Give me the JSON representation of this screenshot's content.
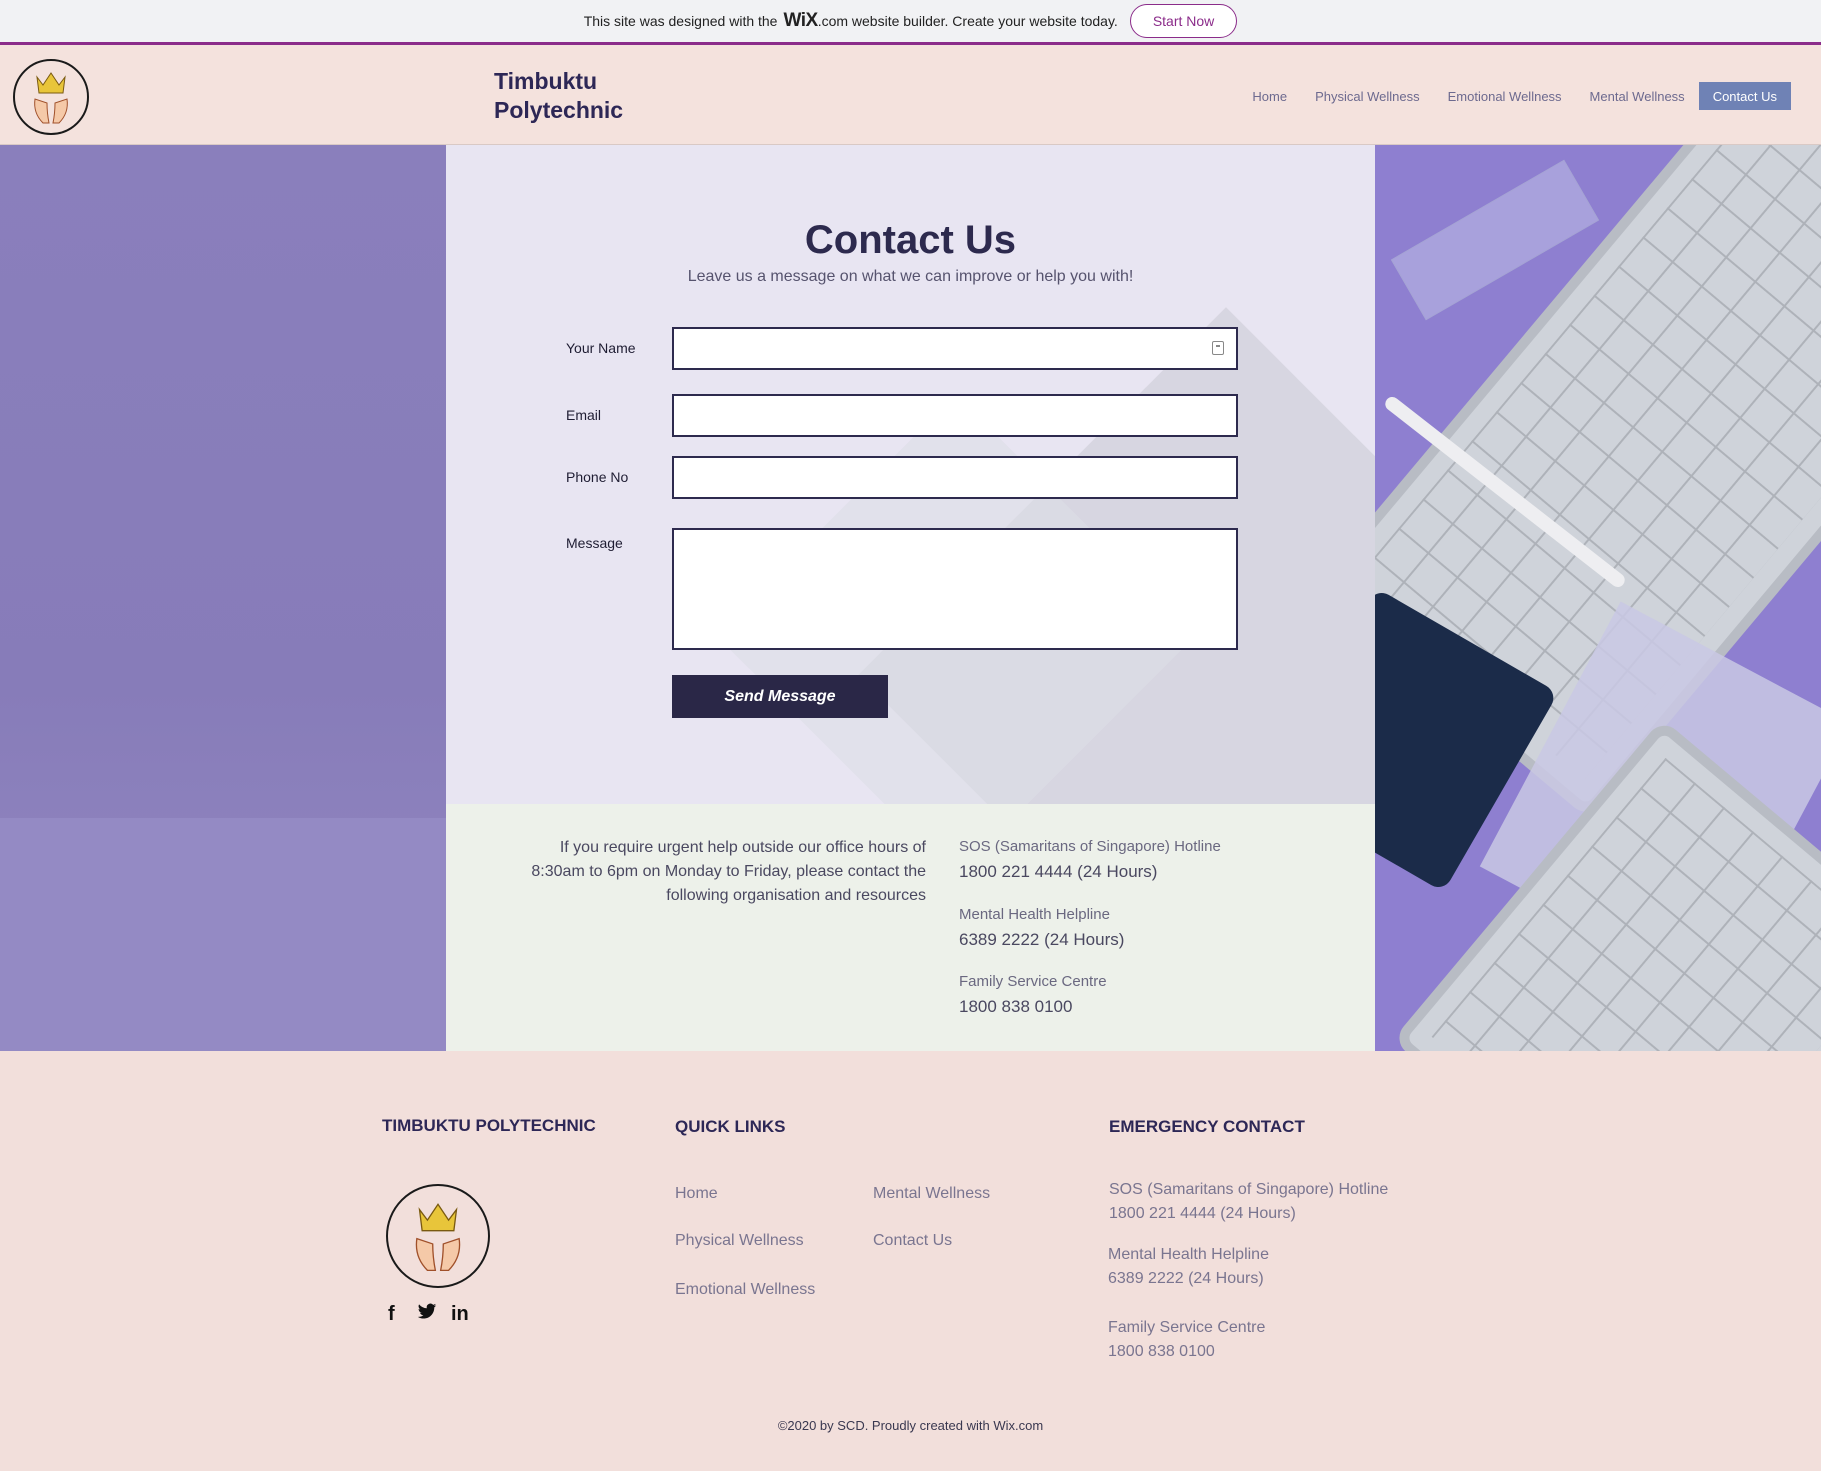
{
  "wix_banner": {
    "text_before": "This site was designed with the",
    "logo": "WiX",
    "text_after": ".com website builder. Create your website today.",
    "cta": "Start Now"
  },
  "header": {
    "brand_line1": "Timbuktu",
    "brand_line2": "Polytechnic",
    "nav": [
      "Home",
      "Physical Wellness",
      "Emotional Wellness",
      "Mental Wellness",
      "Contact Us"
    ],
    "active_nav": "Contact Us"
  },
  "contact": {
    "title": "Contact Us",
    "subtitle": "Leave us a message on what we can improve or help you with!",
    "fields": {
      "name": {
        "label": "Your Name",
        "value": ""
      },
      "email": {
        "label": "Email",
        "value": ""
      },
      "phone": {
        "label": "Phone No",
        "value": ""
      },
      "message": {
        "label": "Message",
        "value": ""
      }
    },
    "submit": "Send Message"
  },
  "info": {
    "intro_line1": "If you require urgent help outside our office hours of",
    "intro_line2": "8:30am to 6pm on Monday to Friday, please contact the",
    "intro_line3": "following organisation and resources",
    "hotlines": [
      {
        "label": "SOS (Samaritans of Singapore) Hotline",
        "number": "1800 221 4444 (24 Hours)"
      },
      {
        "label": "Mental Health Helpline",
        "number": "6389 2222 (24 Hours)"
      },
      {
        "label": "Family Service Centre",
        "number": "1800 838 0100"
      }
    ]
  },
  "footer": {
    "brand_heading": "TIMBUKTU POLYTECHNIC",
    "quick_links_heading": "QUICK LINKS",
    "quick_links": [
      "Home",
      "Physical Wellness",
      "Emotional Wellness",
      "Mental Wellness",
      "Contact Us"
    ],
    "emergency_heading": "EMERGENCY CONTACT",
    "emergency": [
      {
        "label": "SOS (Samaritans of Singapore) Hotline",
        "number": "1800 221 4444 (24 Hours)"
      },
      {
        "label": "Mental Health Helpline",
        "number": "6389 2222 (24 Hours)"
      },
      {
        "label": "Family Service Centre",
        "number": "1800 838 0100"
      }
    ],
    "social_icons": [
      "facebook-icon",
      "twitter-icon",
      "linkedin-icon"
    ],
    "copyright": "©2020 by SCD. Proudly created with Wix.com"
  }
}
